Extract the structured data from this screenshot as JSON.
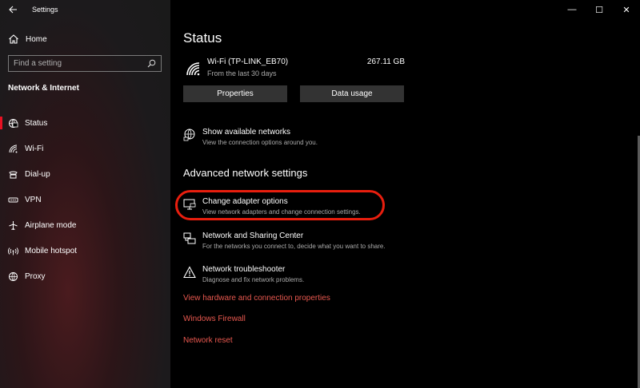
{
  "window": {
    "title": "Settings",
    "controls": {
      "minimize": "—",
      "maximize": "☐",
      "close": "✕"
    }
  },
  "sidebar": {
    "home_label": "Home",
    "search_placeholder": "Find a setting",
    "section_title": "Network & Internet",
    "items": [
      {
        "label": "Status",
        "icon": "status-icon",
        "active": true
      },
      {
        "label": "Wi-Fi",
        "icon": "wifi-icon"
      },
      {
        "label": "Dial-up",
        "icon": "dialup-icon"
      },
      {
        "label": "VPN",
        "icon": "vpn-icon"
      },
      {
        "label": "Airplane mode",
        "icon": "airplane-icon"
      },
      {
        "label": "Mobile hotspot",
        "icon": "hotspot-icon"
      },
      {
        "label": "Proxy",
        "icon": "globe-icon"
      }
    ]
  },
  "main": {
    "title": "Status",
    "connection": {
      "name": "Wi-Fi (TP-LINK_EB70)",
      "period": "From the last 30 days",
      "usage": "267.11 GB"
    },
    "buttons": {
      "properties": "Properties",
      "data_usage": "Data usage"
    },
    "show_networks": {
      "title": "Show available networks",
      "desc": "View the connection options around you."
    },
    "advanced_title": "Advanced network settings",
    "options": [
      {
        "title": "Change adapter options",
        "desc": "View network adapters and change connection settings."
      },
      {
        "title": "Network and Sharing Center",
        "desc": "For the networks you connect to, decide what you want to share."
      },
      {
        "title": "Network troubleshooter",
        "desc": "Diagnose and fix network problems."
      }
    ],
    "links": [
      "View hardware and connection properties",
      "Windows Firewall",
      "Network reset"
    ]
  },
  "colors": {
    "accent": "#e81123",
    "link": "#e8584f",
    "highlight": "#e81e0e"
  }
}
